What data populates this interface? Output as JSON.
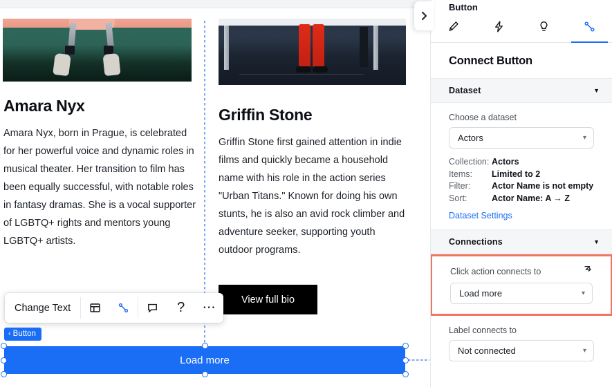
{
  "canvas": {
    "cards": [
      {
        "name": "Amara Nyx",
        "bio": "Amara Nyx, born in Prague, is celebrated for her powerful voice and dynamic roles in musical theater. Her transition to film has been equally successful, with notable roles in fantasy dramas. She is a vocal supporter of LGBTQ+ rights and mentors young LGBTQ+ artists.",
        "image_alt": "legs-with-prosthetics-on-green-wall"
      },
      {
        "name": "Griffin Stone",
        "bio": "Griffin Stone first gained attention in indie films and quickly became a household name with his role in the action series \"Urban Titans.\" Known for doing his own stunts, he is also an avid rock climber and adventure seeker, supporting youth outdoor programs.",
        "image_alt": "person-in-red-pants-behind-table",
        "cta_label": "View full bio"
      }
    ],
    "load_more_label": "Load more",
    "element_badge": "Button",
    "element_badge_chevron": "‹"
  },
  "toolbar": {
    "change_text_label": "Change Text",
    "items": [
      {
        "icon": "layout-icon",
        "name": "layout-button"
      },
      {
        "icon": "connect-icon",
        "name": "connect-button"
      },
      {
        "icon": "comment-icon",
        "name": "comment-button"
      },
      {
        "icon": "help-icon",
        "name": "help-button",
        "glyph": "?"
      },
      {
        "icon": "more-icon",
        "name": "more-button",
        "glyph": "⋯"
      }
    ]
  },
  "panel": {
    "title": "Button",
    "tabs": [
      {
        "label": "Design",
        "icon": "brush-icon",
        "active": false
      },
      {
        "label": "Interactions",
        "icon": "lightning-icon",
        "active": false
      },
      {
        "label": "Tips",
        "icon": "lightbulb-icon",
        "active": false
      },
      {
        "label": "Connect",
        "icon": "connect-icon",
        "active": true
      }
    ],
    "heading": "Connect Button",
    "dataset_section": {
      "title": "Dataset",
      "caret": "▼",
      "choose_label": "Choose a dataset",
      "selected_dataset": "Actors",
      "info": [
        {
          "key": "Collection:",
          "value": "Actors"
        },
        {
          "key": "Items:",
          "value": "Limited to 2"
        },
        {
          "key": "Filter:",
          "value": "Actor Name is not empty"
        },
        {
          "key": "Sort:",
          "value": "Actor Name: A → Z"
        }
      ],
      "settings_link": "Dataset Settings"
    },
    "connections_section": {
      "title": "Connections",
      "caret": "▼",
      "click_action_label": "Click action connects to",
      "click_action_value": "Load more",
      "label_connects_label": "Label connects to",
      "label_connects_value": "Not connected",
      "highlight_color": "#F4745C"
    }
  },
  "colors": {
    "accent_blue": "#1A6EF5",
    "highlight": "#F4745C",
    "cta_black": "#000000"
  }
}
